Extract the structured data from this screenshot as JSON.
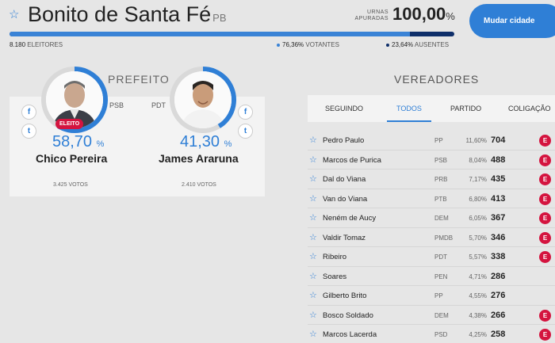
{
  "header": {
    "city": "Bonito de Santa Fé",
    "uf": "PB",
    "urnas_label": "URNAS APURADAS",
    "urnas_value": "100,00",
    "urnas_pct_sign": "%",
    "change_city_label": "Mudar cidade",
    "progress_fraction": 0.9
  },
  "stats": {
    "eleitores_count": "8.180",
    "eleitores_label": "ELEITORES",
    "votantes_pct": "76,36%",
    "votantes_label": "VOTANTES",
    "ausentes_pct": "23,64%",
    "ausentes_label": "AUSENTES"
  },
  "prefeito": {
    "title": "PREFEITO",
    "candidates": [
      {
        "name": "Chico Pereira",
        "party": "PSB",
        "pct": "58,70",
        "pct_sign": "%",
        "votes": "3.425 VOTOS",
        "badge": "ELEITO",
        "share": 0.587
      },
      {
        "name": "James Araruna",
        "party": "PDT",
        "pct": "41,30",
        "pct_sign": "%",
        "votes": "2.410 VOTOS",
        "share": 0.413
      }
    ]
  },
  "vereadores": {
    "title": "VEREADORES",
    "tabs": [
      "SEGUINDO",
      "TODOS",
      "PARTIDO",
      "COLIGAÇÃO"
    ],
    "active_tab": "TODOS",
    "elected_badge": "E",
    "rows": [
      {
        "name": "Pedro Paulo",
        "party": "PP",
        "pct": "11,60%",
        "votes": "704",
        "elected": true
      },
      {
        "name": "Marcos de Purica",
        "party": "PSB",
        "pct": "8,04%",
        "votes": "488",
        "elected": true
      },
      {
        "name": "Dal do Viana",
        "party": "PRB",
        "pct": "7,17%",
        "votes": "435",
        "elected": true
      },
      {
        "name": "Van do Viana",
        "party": "PTB",
        "pct": "6,80%",
        "votes": "413",
        "elected": true
      },
      {
        "name": "Neném de Aucy",
        "party": "DEM",
        "pct": "6,05%",
        "votes": "367",
        "elected": true
      },
      {
        "name": "Valdir Tomaz",
        "party": "PMDB",
        "pct": "5,70%",
        "votes": "346",
        "elected": true
      },
      {
        "name": "Ribeiro",
        "party": "PDT",
        "pct": "5,57%",
        "votes": "338",
        "elected": true
      },
      {
        "name": "Soares",
        "party": "PEN",
        "pct": "4,71%",
        "votes": "286",
        "elected": false
      },
      {
        "name": "Gilberto Brito",
        "party": "PP",
        "pct": "4,55%",
        "votes": "276",
        "elected": false
      },
      {
        "name": "Bosco Soldado",
        "party": "DEM",
        "pct": "4,38%",
        "votes": "266",
        "elected": true
      },
      {
        "name": "Marcos Lacerda",
        "party": "PSD",
        "pct": "4,25%",
        "votes": "258",
        "elected": true
      }
    ]
  },
  "icons": {
    "star": "star-icon",
    "facebook": "facebook-icon",
    "twitter": "twitter-icon"
  },
  "colors": {
    "accent": "#2f7fd6",
    "progress_dark": "#0f2f6a",
    "elected_red": "#d4143f"
  }
}
